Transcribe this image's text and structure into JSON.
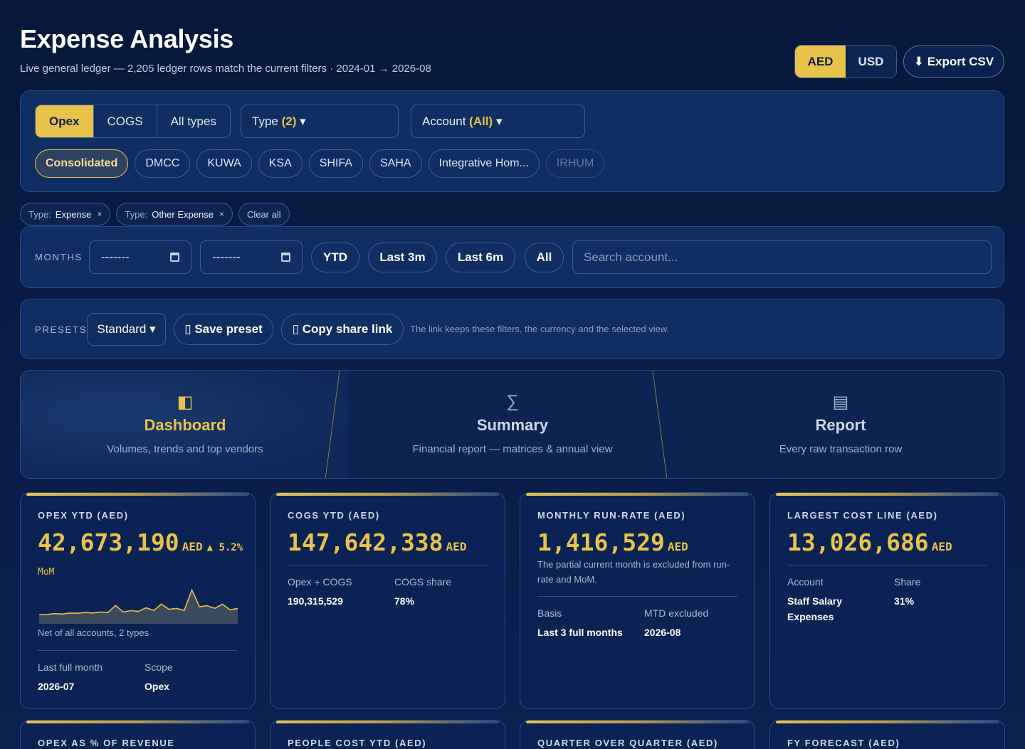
{
  "header": {
    "title": "Expense Analysis",
    "subtitle": "Live general ledger — 2,205 ledger rows match the current filters · 2024-01 → 2026-08",
    "currency": {
      "active": "AED",
      "other": "USD"
    },
    "export_label": "⬇ Export CSV"
  },
  "filters": {
    "types": [
      "Opex",
      "COGS",
      "All types"
    ],
    "type_dropdown": {
      "label": "Type",
      "value": "(2)",
      "caret": "▾"
    },
    "account_dropdown": {
      "label": "Account",
      "value": "(All)",
      "caret": "▾"
    },
    "entities": [
      "Consolidated",
      "DMCC",
      "KUWA",
      "KSA",
      "SHIFA",
      "SAHA",
      "Integrative Hom...",
      "IRHUM"
    ],
    "active_tags": [
      {
        "key": "Type:",
        "value": "Expense",
        "remove": "×"
      },
      {
        "key": "Type:",
        "value": "Other Expense",
        "remove": "×"
      }
    ],
    "clear_all": "Clear all"
  },
  "months": {
    "label": "MONTHS",
    "from": "-------",
    "to": "-------",
    "ranges": [
      "YTD",
      "Last 3m",
      "Last 6m",
      "All"
    ],
    "search_placeholder": "Search account..."
  },
  "presets": {
    "label": "PRESETS",
    "selected": "Standard ▾",
    "save": "▯ Save preset",
    "copy": "▯ Copy share link",
    "note": "The link keeps these filters, the currency and the selected view."
  },
  "views": [
    {
      "icon": "◧",
      "title": "Dashboard",
      "desc": "Volumes, trends and top vendors"
    },
    {
      "icon": "∑",
      "title": "Summary",
      "desc": "Financial report — matrices & annual view"
    },
    {
      "icon": "▤",
      "title": "Report",
      "desc": "Every raw transaction row"
    }
  ],
  "kpis": [
    {
      "label": "OPEX YTD (AED)",
      "value": "42,673,190",
      "unit": "AED",
      "delta": "▲ 5.2%",
      "mom": "MoM",
      "caption": "Net of all accounts, 2 types",
      "f1k": "Last full month",
      "f1v": "2026-07",
      "f2k": "Scope",
      "f2v": "Opex",
      "spark": [
        3,
        3,
        3.4,
        3.2,
        3.6,
        3.5,
        3.8,
        3.6,
        4,
        3.8,
        6.5,
        4,
        4.5,
        4.2,
        5.6,
        4.6,
        7,
        5,
        5.4,
        4.6,
        12.5,
        6,
        6.4,
        5.4,
        7,
        4.8,
        5.4
      ]
    },
    {
      "label": "COGS YTD (AED)",
      "value": "147,642,338",
      "unit": "AED",
      "f1k": "Opex + COGS",
      "f1v": "190,315,529",
      "f2k": "COGS share",
      "f2v": "78%"
    },
    {
      "label": "MONTHLY RUN-RATE (AED)",
      "value": "1,416,529",
      "unit": "AED",
      "note": "The partial current month is excluded from run-rate and MoM.",
      "f1k": "Basis",
      "f1v": "Last 3 full months",
      "f2k": "MTD excluded",
      "f2v": "2026-08"
    },
    {
      "label": "LARGEST COST LINE (AED)",
      "value": "13,026,686",
      "unit": "AED",
      "f1k": "Account",
      "f1v": "Staff Salary Expenses",
      "f2k": "Share",
      "f2v": "31%"
    }
  ],
  "kpis_row2": [
    "OPEX AS % OF REVENUE",
    "PEOPLE COST YTD (AED)",
    "QUARTER OVER QUARTER (AED)",
    "FY FORECAST (AED)"
  ]
}
